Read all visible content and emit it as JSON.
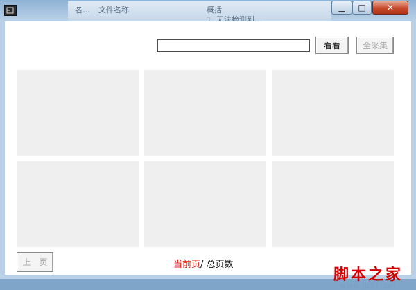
{
  "window": {
    "minimize_glyph": "▁",
    "maximize_glyph": "□",
    "close_glyph": "✕"
  },
  "background_window": {
    "text_1": "名...",
    "text_2": "文件名称",
    "text_3": "概括",
    "text_4": "1. 无法检测到…"
  },
  "toolbar": {
    "search_value": "",
    "view_label": "看看",
    "collect_all_label": "全采集"
  },
  "thumbnails": [
    "",
    "",
    "",
    "",
    "",
    ""
  ],
  "pager": {
    "prev_label": "上一页",
    "current_page_label": "当前页",
    "separator": "/",
    "total_pages_label": "总页数"
  },
  "watermark": {
    "main": "脚本之家",
    "sub": "www.jb51.net"
  },
  "colors": {
    "client_bg": "#ffffff",
    "thumbnail_bg": "#efefef",
    "current_page_color": "#e0261f",
    "watermark_color": "#d40000"
  }
}
